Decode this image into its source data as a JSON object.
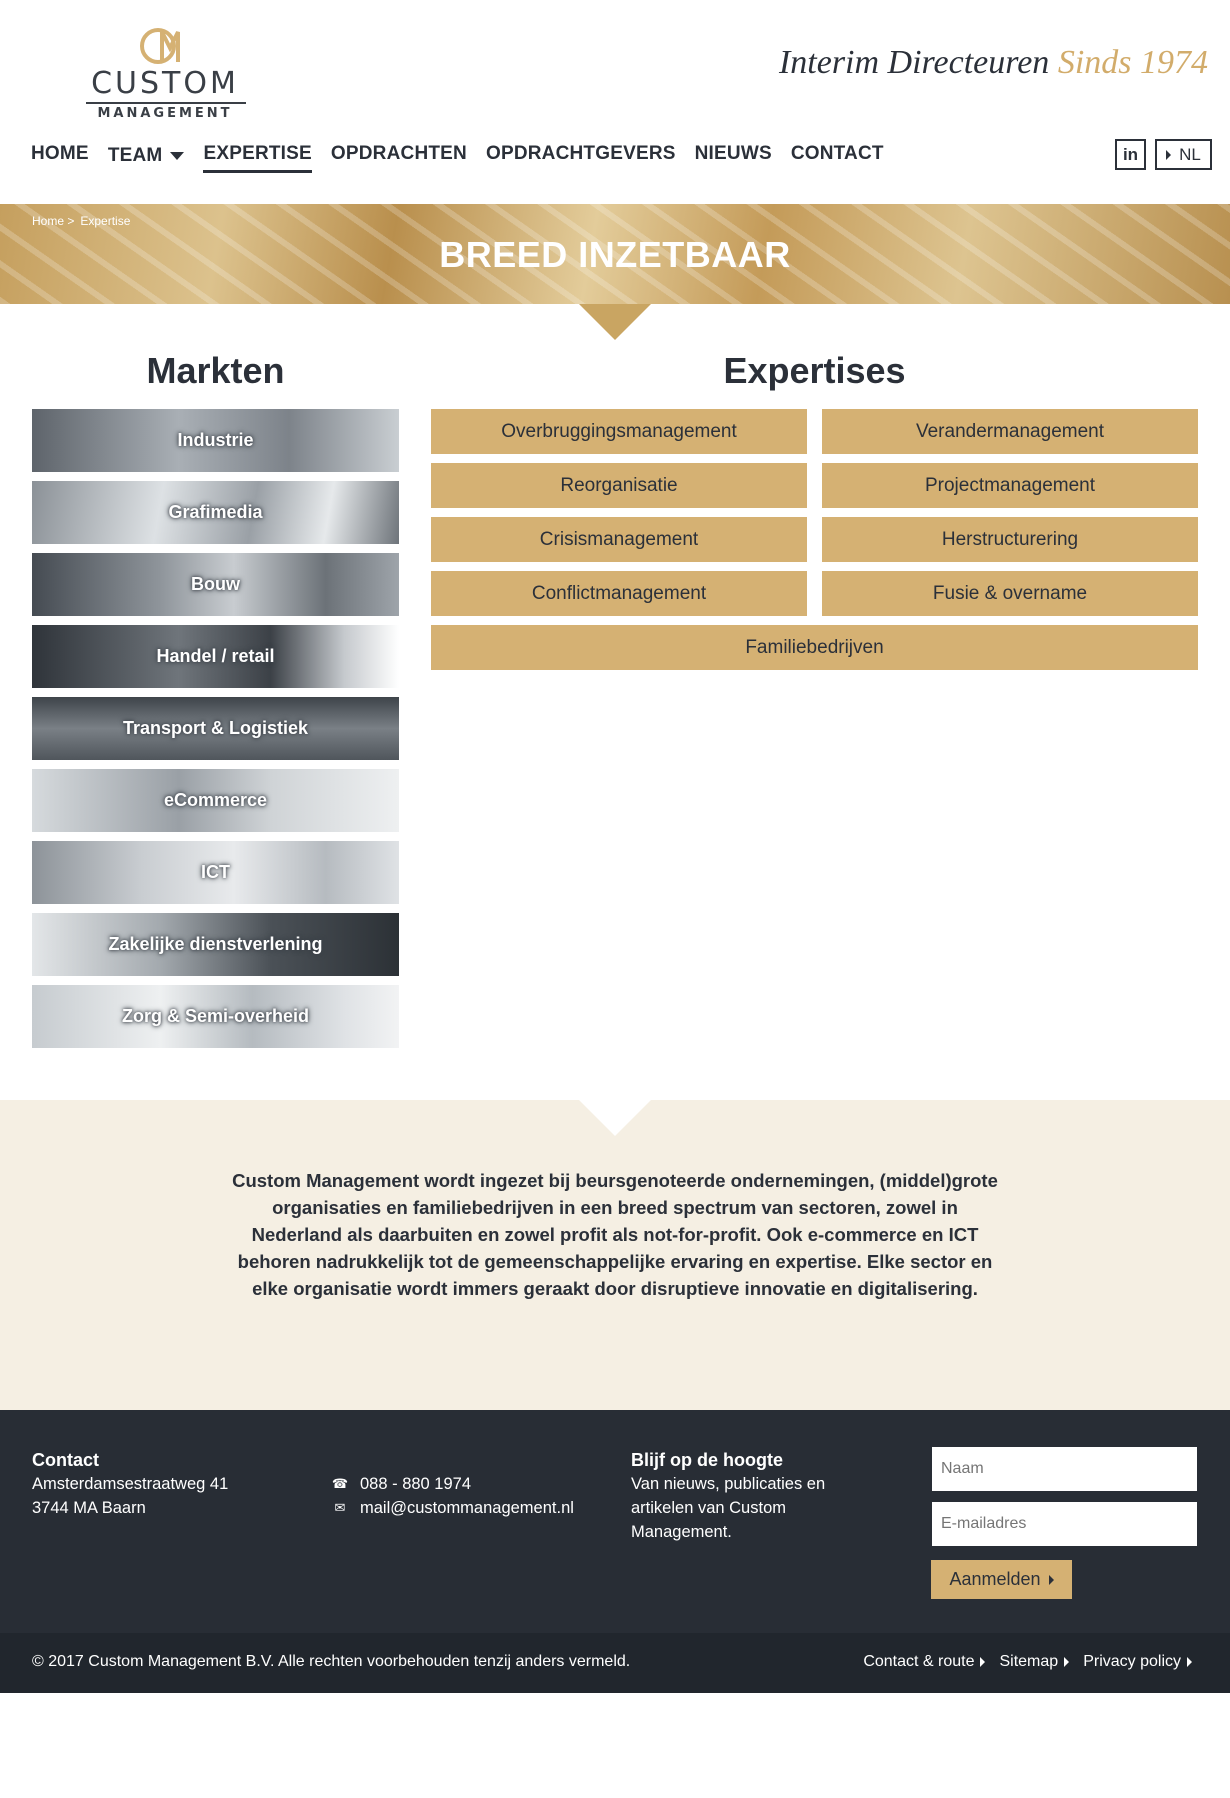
{
  "brand": {
    "logo_word": "CUSTOM",
    "logo_sub": "MANAGEMENT",
    "tagline_part1": "Interim Directeuren",
    "tagline_part2": "Sinds 1974",
    "color_gold": "#d5b173",
    "color_dark": "#2b3039"
  },
  "nav": {
    "items": [
      "HOME",
      "TEAM",
      "EXPERTISE",
      "OPDRACHTEN",
      "OPDRACHTGEVERS",
      "NIEUWS",
      "CONTACT"
    ],
    "active": "EXPERTISE",
    "linkedin_label": "in",
    "lang_label": "NL"
  },
  "banner": {
    "breadcrumb": [
      "Home >",
      "Expertise"
    ],
    "title": "BREED INZETBAAR"
  },
  "markets": {
    "heading": "Markten",
    "items": [
      "Industrie",
      "Grafimedia",
      "Bouw",
      "Handel / retail",
      "Transport & Logistiek",
      "eCommerce",
      "ICT",
      "Zakelijke dienstverlening",
      "Zorg & Semi-overheid"
    ]
  },
  "expertises": {
    "heading": "Expertises",
    "items": [
      "Overbruggingsmanagement",
      "Verandermanagement",
      "Reorganisatie",
      "Projectmanagement",
      "Crisismanagement",
      "Herstructurering",
      "Conflictmanagement",
      "Fusie & overname",
      "Familiebedrijven"
    ]
  },
  "intro": {
    "text": "Custom Management wordt ingezet bij beursgenoteerde ondernemingen, (middel)grote organisaties en familiebedrijven in een breed spectrum van sectoren, zowel in Nederland als daarbuiten en zowel profit als not-for-profit. Ook e-commerce en ICT behoren nadrukkelijk tot de gemeenschappelijke ervaring en expertise. Elke sector en elke organisatie wordt immers geraakt door disruptieve innovatie  en digitalisering."
  },
  "footer": {
    "contact_heading": "Contact",
    "address_line1": "Amsterdamsestraatweg 41",
    "address_line2": "3744 MA Baarn",
    "phone": "088 - 880 1974",
    "email": "mail@custommanagement.nl",
    "newsletter_heading": "Blijf op de hoogte",
    "newsletter_text": "Van nieuws, publicaties en artikelen van Custom Management.",
    "name_placeholder": "Naam",
    "email_placeholder": "E-mailadres",
    "submit_label": "Aanmelden"
  },
  "bottom": {
    "copyright": "© 2017 Custom Management B.V. Alle rechten voorbehouden tenzij anders vermeld.",
    "links": [
      "Contact & route",
      "Sitemap",
      "Privacy policy"
    ]
  }
}
